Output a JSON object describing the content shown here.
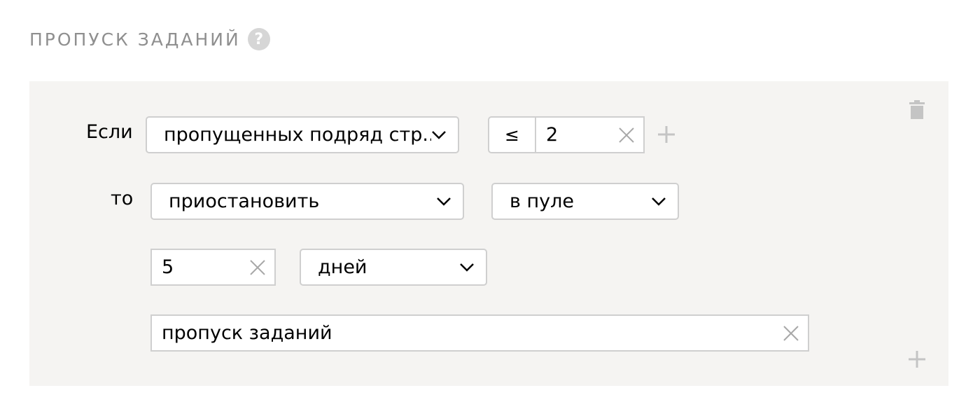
{
  "section": {
    "title": "ПРОПУСК ЗАДАНИЙ",
    "help_label": "?"
  },
  "rule": {
    "if_label": "Если",
    "then_label": "то",
    "condition_field": "пропущенных подряд стр...",
    "operator": "≤",
    "threshold_value": "2",
    "action": "приостановить",
    "scope": "в пуле",
    "duration_value": "5",
    "duration_unit": "дней",
    "reason_value": "пропуск заданий"
  },
  "colors": {
    "panel_bg": "#f5f4f2",
    "border": "#cfcfcf",
    "muted_text": "#8f8f8f",
    "icon_gray": "#c4c4c4"
  }
}
